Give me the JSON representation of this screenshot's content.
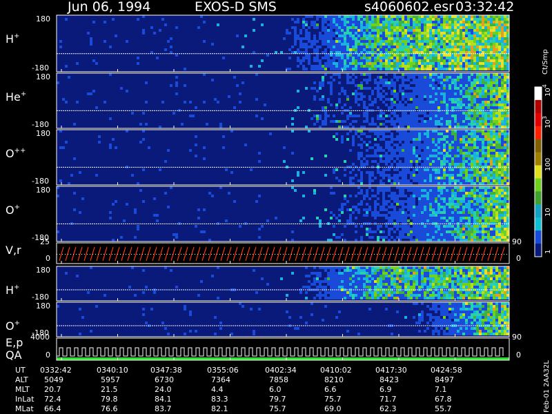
{
  "header": {
    "date": "Jun 06, 1994",
    "mission": "EXOS-D SMS",
    "file": "s4060602.esr",
    "time": "03:32:42"
  },
  "footer_id": "Feb-01 2AA32L",
  "colors": {
    "background": "#000000",
    "spectrogram_base": "#0a1a7a",
    "vr_trace": "#ff3a10",
    "qa_bar": "#30e030"
  },
  "colorbar": {
    "unit": "Ct/Smp",
    "tick_labels": [
      "1",
      "10",
      "100",
      "10",
      "10"
    ],
    "tick_exponents": [
      "",
      "",
      "",
      "3",
      "4"
    ],
    "scale": "log"
  },
  "chart_data": [
    {
      "type": "heatmap",
      "panel": "H+ (1)",
      "ion": "H",
      "charge": "+",
      "ylim": [
        -180,
        180
      ],
      "y_tick_labels": [
        "180",
        "-180"
      ],
      "x": [
        "0332:42",
        "0340:10",
        "0347:38",
        "0355:06",
        "0402:34",
        "0410:02",
        "0417:30",
        "0424:58"
      ],
      "activity": [
        0.05,
        0.08,
        0.1,
        0.1,
        0.35,
        0.75,
        0.85,
        0.95
      ]
    },
    {
      "type": "heatmap",
      "panel": "He+",
      "ion": "He",
      "charge": "+",
      "ylim": [
        -180,
        180
      ],
      "y_tick_labels": [
        "180",
        "-180"
      ],
      "x": [
        "0332:42",
        "0340:10",
        "0347:38",
        "0355:06",
        "0402:34",
        "0410:02",
        "0417:30",
        "0424:58"
      ],
      "activity": [
        0.02,
        0.03,
        0.03,
        0.03,
        0.25,
        0.3,
        0.5,
        0.85
      ]
    },
    {
      "type": "heatmap",
      "panel": "O++",
      "ion": "O",
      "charge": "++",
      "ylim": [
        -180,
        180
      ],
      "y_tick_labels": [
        "180",
        "-180"
      ],
      "x": [
        "0332:42",
        "0340:10",
        "0347:38",
        "0355:06",
        "0402:34",
        "0410:02",
        "0417:30",
        "0424:58"
      ],
      "activity": [
        0.02,
        0.03,
        0.03,
        0.03,
        0.2,
        0.3,
        0.55,
        0.85
      ]
    },
    {
      "type": "heatmap",
      "panel": "O+ (1)",
      "ion": "O",
      "charge": "+",
      "ylim": [
        -180,
        180
      ],
      "y_tick_labels": [
        "180",
        "-180"
      ],
      "x": [
        "0332:42",
        "0340:10",
        "0347:38",
        "0355:06",
        "0402:34",
        "0410:02",
        "0417:30",
        "0424:58"
      ],
      "activity": [
        0.02,
        0.03,
        0.05,
        0.03,
        0.2,
        0.3,
        0.55,
        0.85
      ]
    },
    {
      "type": "line",
      "panel": "V,r",
      "label": "V,r",
      "ylim": [
        0,
        25
      ],
      "y_tick_labels": [
        "25",
        "0"
      ],
      "right_tick_labels": [
        "90",
        "0"
      ]
    },
    {
      "type": "heatmap",
      "panel": "H+ (2)",
      "ion": "H",
      "charge": "+",
      "ylim": [
        -180,
        180
      ],
      "y_tick_labels": [
        "180",
        "-180"
      ],
      "x": [
        "0332:42",
        "0340:10",
        "0347:38",
        "0355:06",
        "0402:34",
        "0410:02",
        "0417:30",
        "0424:58"
      ],
      "activity": [
        0.0,
        0.0,
        0.0,
        0.0,
        0.3,
        0.7,
        0.7,
        0.9
      ]
    },
    {
      "type": "heatmap",
      "panel": "O+ (2)",
      "ion": "O",
      "charge": "+",
      "ylim": [
        -180,
        180
      ],
      "y_tick_labels": [
        "180",
        "-180"
      ],
      "x": [
        "0332:42",
        "0340:10",
        "0347:38",
        "0355:06",
        "0402:34",
        "0410:02",
        "0417:30",
        "0424:58"
      ],
      "activity": [
        0.0,
        0.0,
        0.0,
        0.0,
        0.02,
        0.05,
        0.4,
        0.85
      ]
    },
    {
      "type": "line",
      "panel": "E,p QA",
      "label_top": "E,p",
      "label_bottom": "QA",
      "ylim": [
        0,
        4000
      ],
      "y_tick_labels": [
        "4000",
        "0"
      ],
      "right_tick_labels": [
        "90",
        "0"
      ]
    }
  ],
  "ephemeris": {
    "rows": [
      {
        "label": "UT",
        "values": [
          "0332:42",
          "0340:10",
          "0347:38",
          "0355:06",
          "0402:34",
          "0410:02",
          "0417:30",
          "0424:58"
        ]
      },
      {
        "label": "ALT",
        "values": [
          "5049",
          "5957",
          "6730",
          "7364",
          "7858",
          "8210",
          "8423",
          "8497"
        ]
      },
      {
        "label": "MLT",
        "values": [
          "20.7",
          "21.5",
          "24.0",
          "4.4",
          "6.0",
          "6.6",
          "6.9",
          "7.1"
        ]
      },
      {
        "label": "InLat",
        "values": [
          "72.4",
          "79.8",
          "84.1",
          "83.3",
          "79.7",
          "75.7",
          "71.7",
          "67.8"
        ]
      },
      {
        "label": "MLat",
        "values": [
          "66.4",
          "76.6",
          "83.7",
          "82.1",
          "75.7",
          "69.0",
          "62.3",
          "55.7"
        ]
      }
    ]
  }
}
